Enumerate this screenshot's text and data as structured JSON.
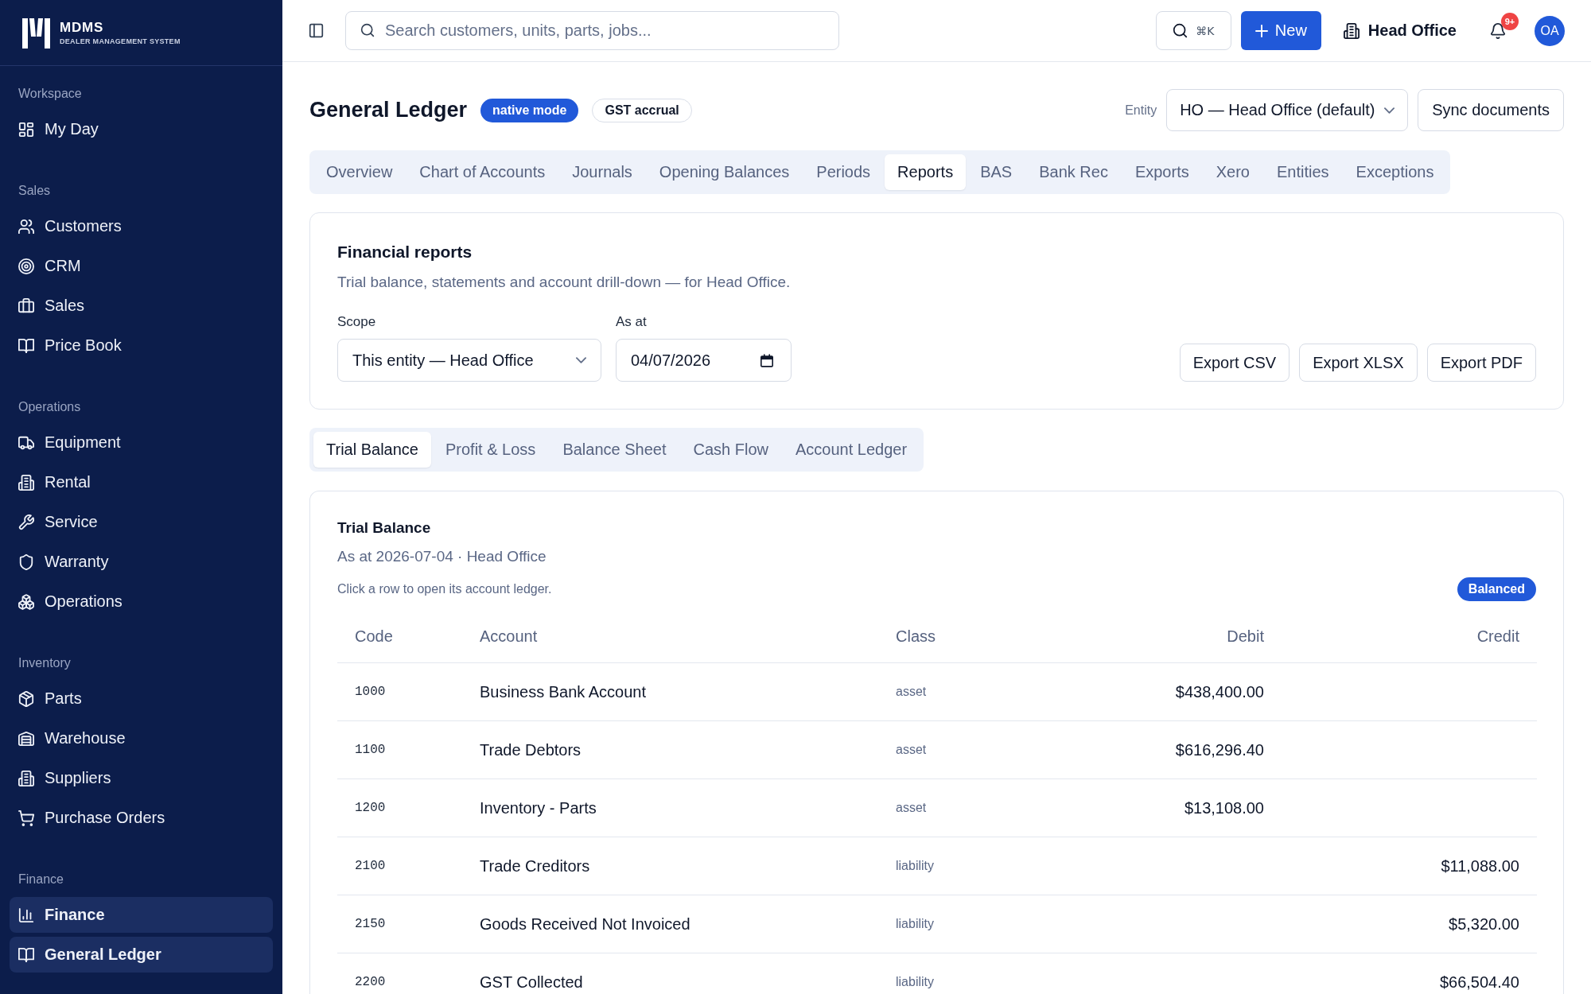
{
  "sidebar": {
    "brand": {
      "name": "MDMS",
      "tagline": "DEALER MANAGEMENT SYSTEM"
    },
    "sections": [
      {
        "label": "Workspace",
        "items": [
          {
            "label": "My Day",
            "selected": false
          }
        ]
      },
      {
        "label": "Sales",
        "items": [
          {
            "label": "Customers",
            "selected": false
          },
          {
            "label": "CRM",
            "selected": false
          },
          {
            "label": "Sales",
            "selected": false
          },
          {
            "label": "Price Book",
            "selected": false
          }
        ]
      },
      {
        "label": "Operations",
        "items": [
          {
            "label": "Equipment",
            "selected": false
          },
          {
            "label": "Rental",
            "selected": false
          },
          {
            "label": "Service",
            "selected": false
          },
          {
            "label": "Warranty",
            "selected": false
          },
          {
            "label": "Operations",
            "selected": false
          }
        ]
      },
      {
        "label": "Inventory",
        "items": [
          {
            "label": "Parts",
            "selected": false
          },
          {
            "label": "Warehouse",
            "selected": false
          },
          {
            "label": "Suppliers",
            "selected": false
          },
          {
            "label": "Purchase Orders",
            "selected": false
          }
        ]
      },
      {
        "label": "Finance",
        "items": [
          {
            "label": "Finance",
            "selected": true
          },
          {
            "label": "General Ledger",
            "selected": true
          }
        ]
      }
    ]
  },
  "topbar": {
    "search": {
      "placeholder": "Search customers, units, parts, jobs..."
    },
    "command_shortcut": "⌘K",
    "new_button": "New",
    "office_switcher": "Head Office",
    "notifications": {
      "badge": "9+"
    },
    "avatar": "OA"
  },
  "page_header": {
    "title": "General Ledger",
    "badges": [
      {
        "label": "native mode",
        "kind": "filled"
      },
      {
        "label": "GST accrual",
        "kind": "outline"
      }
    ],
    "entity_label": "Entity",
    "entity_select": {
      "value": "HO — Head Office (default)"
    },
    "sync_button": "Sync documents"
  },
  "tabs": [
    {
      "label": "Overview",
      "selected": false
    },
    {
      "label": "Chart of Accounts",
      "selected": false
    },
    {
      "label": "Journals",
      "selected": false
    },
    {
      "label": "Opening Balances",
      "selected": false
    },
    {
      "label": "Periods",
      "selected": false
    },
    {
      "label": "Reports",
      "selected": true
    },
    {
      "label": "BAS",
      "selected": false
    },
    {
      "label": "Bank Rec",
      "selected": false
    },
    {
      "label": "Exports",
      "selected": false
    },
    {
      "label": "Xero",
      "selected": false
    },
    {
      "label": "Entities",
      "selected": false
    },
    {
      "label": "Exceptions",
      "selected": false
    }
  ],
  "report_panel": {
    "title": "Financial reports",
    "subtitle": "Trial balance, statements and account drill-down — for Head Office.",
    "scope": {
      "label": "Scope",
      "value": "This entity — Head Office"
    },
    "as_at": {
      "label": "As at",
      "value": "04/07/2026"
    },
    "export_buttons": [
      "Export CSV",
      "Export XLSX",
      "Export PDF"
    ]
  },
  "report_tabs": [
    {
      "label": "Trial Balance",
      "selected": true
    },
    {
      "label": "Profit & Loss",
      "selected": false
    },
    {
      "label": "Balance Sheet",
      "selected": false
    },
    {
      "label": "Cash Flow",
      "selected": false
    },
    {
      "label": "Account Ledger",
      "selected": false
    }
  ],
  "trial_balance": {
    "title": "Trial Balance",
    "subtitle": "As at 2026-07-04 · Head Office",
    "hint": "Click a row to open its account ledger.",
    "status_badge": "Balanced",
    "columns": [
      "Code",
      "Account",
      "Class",
      "Debit",
      "Credit"
    ],
    "rows": [
      {
        "code": "1000",
        "account": "Business Bank Account",
        "class": "asset",
        "debit": "$438,400.00"
      },
      {
        "code": "1100",
        "account": "Trade Debtors",
        "class": "asset",
        "debit": "$616,296.40"
      },
      {
        "code": "1200",
        "account": "Inventory - Parts",
        "class": "asset",
        "debit": "$13,108.00"
      },
      {
        "code": "2100",
        "account": "Trade Creditors",
        "class": "liability",
        "credit": "$11,088.00"
      },
      {
        "code": "2150",
        "account": "Goods Received Not Invoiced",
        "class": "liability",
        "credit": "$5,320.00"
      },
      {
        "code": "2200",
        "account": "GST Collected",
        "class": "liability",
        "credit": "$66,504.40"
      }
    ]
  }
}
